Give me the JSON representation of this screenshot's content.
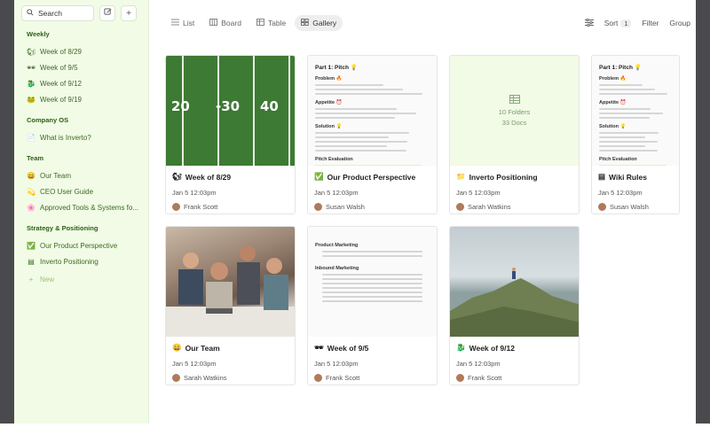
{
  "sidebar": {
    "search_label": "Search",
    "sections": [
      {
        "title": "Weekly",
        "items": [
          {
            "emoji": "🐿",
            "label": "Week of 8/29"
          },
          {
            "emoji": "🕶",
            "label": "Week of 9/5"
          },
          {
            "emoji": "🐉",
            "label": "Week of 9/12"
          },
          {
            "emoji": "🐸",
            "label": "Week of 9/19"
          }
        ]
      },
      {
        "title": "Company OS",
        "items": [
          {
            "emoji": "📄",
            "label": "What is Inverto?"
          }
        ]
      },
      {
        "title": "Team",
        "items": [
          {
            "emoji": "😄",
            "label": "Our Team"
          },
          {
            "emoji": "💫",
            "label": "CEO User Guide"
          },
          {
            "emoji": "🌸",
            "label": "Approved Tools & Systems fo..."
          }
        ]
      },
      {
        "title": "Strategy & Positioning",
        "items": [
          {
            "emoji": "✅",
            "label": "Our Product Perspective"
          },
          {
            "emoji": "▤",
            "label": "Inverto Positioning"
          }
        ]
      }
    ],
    "new_label": "New"
  },
  "toolbar": {
    "views": [
      {
        "icon": "list-icon",
        "label": "List"
      },
      {
        "icon": "board-icon",
        "label": "Board"
      },
      {
        "icon": "table-icon",
        "label": "Table"
      },
      {
        "icon": "gallery-icon",
        "label": "Gallery"
      }
    ],
    "active_view": "Gallery",
    "sort_label": "Sort",
    "sort_count": "1",
    "filter_label": "Filter",
    "group_label": "Group"
  },
  "cards": [
    {
      "emoji": "🐿",
      "title": "Week of 8/29",
      "date": "Jan 5 12:03pm",
      "author": "Frank Scott",
      "cover": "football-field",
      "yard_numbers": [
        "20",
        "-30",
        "40"
      ]
    },
    {
      "emoji": "✅",
      "title": "Our Product Perspective",
      "date": "Jan 5 12:03pm",
      "author": "Susan Walsh",
      "cover": "document",
      "doc_title": "Part 1: Pitch 💡",
      "doc_sections": [
        "Problem 🔥",
        "Appetite ⏰",
        "Solution 💡",
        "Pitch Evaluation"
      ]
    },
    {
      "emoji": "📁",
      "title": "Inverto Positioning",
      "date": "Jan 5 12:03pm",
      "author": "Sarah Watkins",
      "cover": "folder",
      "folders": "10 Folders",
      "docs": "33 Docs"
    },
    {
      "emoji": "▤",
      "title": "Wiki Rules",
      "date": "Jan 5 12:03pm",
      "author": "Susan Walsh",
      "cover": "document",
      "doc_title": "Part 1: Pitch 💡",
      "doc_sections": [
        "Problem 🔥",
        "Appetite ⏰",
        "Solution 💡",
        "Pitch Evaluation"
      ]
    },
    {
      "emoji": "😄",
      "title": "Our Team",
      "date": "Jan 5 12:03pm",
      "author": "Sarah Watkins",
      "cover": "people-photo"
    },
    {
      "emoji": "🕶",
      "title": "Week of 9/5",
      "date": "Jan 5 12:03pm",
      "author": "Frank Scott",
      "cover": "table",
      "table_sections": [
        "Product Marketing",
        "Inbound Marketing"
      ]
    },
    {
      "emoji": "🐉",
      "title": "Week of 9/12",
      "date": "Jan 5 12:03pm",
      "author": "Frank Scott",
      "cover": "mountain-photo"
    }
  ],
  "colors": {
    "sidebar_bg": "#f1fbe6",
    "sidebar_text": "#3d6b22",
    "accent": "#2e5e16"
  }
}
